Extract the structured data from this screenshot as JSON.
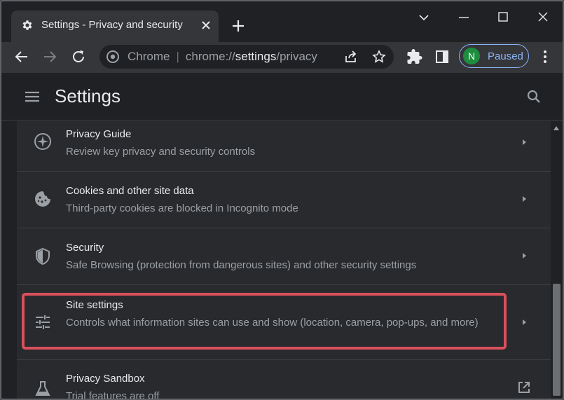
{
  "tab": {
    "title": "Settings - Privacy and security"
  },
  "omnibox": {
    "host_label": "Chrome",
    "url_scheme": "chrome://",
    "url_host": "settings",
    "url_path": "/privacy"
  },
  "profile": {
    "initial": "N",
    "label": "Paused"
  },
  "header": {
    "title": "Settings"
  },
  "rows": [
    {
      "title": "Privacy Guide",
      "subtitle": "Review key privacy and security controls",
      "icon": "compass-icon"
    },
    {
      "title": "Cookies and other site data",
      "subtitle": "Third-party cookies are blocked in Incognito mode",
      "icon": "cookie-icon"
    },
    {
      "title": "Security",
      "subtitle": "Safe Browsing (protection from dangerous sites) and other security settings",
      "icon": "shield-icon"
    },
    {
      "title": "Site settings",
      "subtitle": "Controls what information sites can use and show (location, camera, pop-ups, and more)",
      "icon": "tune-sliders-icon"
    },
    {
      "title": "Privacy Sandbox",
      "subtitle": "Trial features are off",
      "icon": "flask-icon"
    }
  ],
  "colors": {
    "accent": "#8ab4f8",
    "highlight": "#d9505c",
    "avatar": "#1e8e3e"
  }
}
